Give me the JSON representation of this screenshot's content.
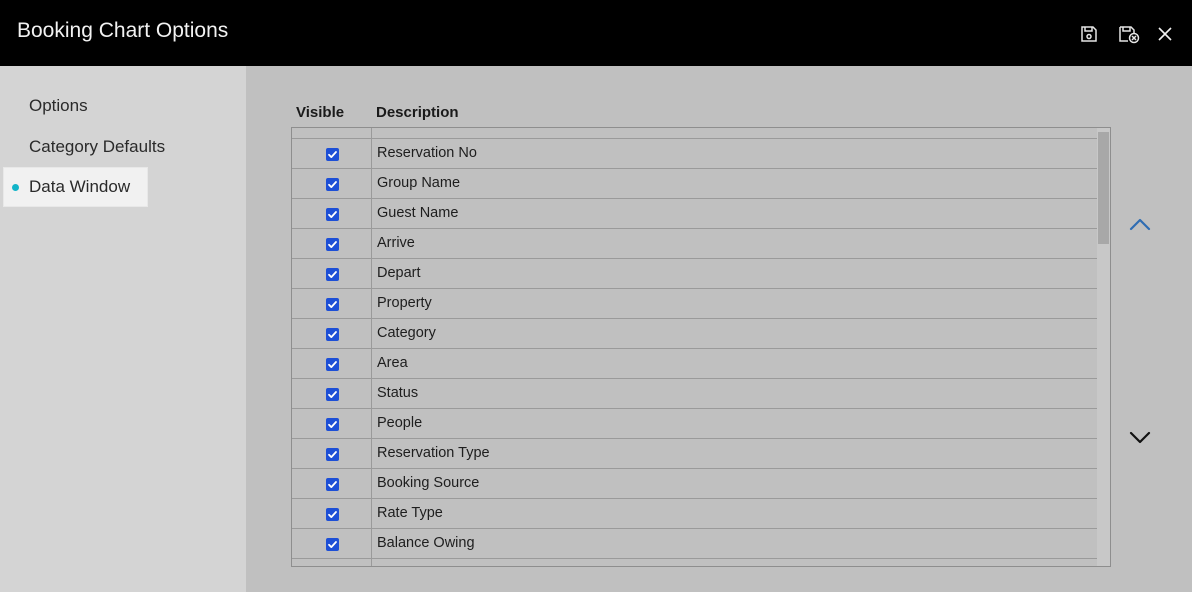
{
  "window": {
    "title": "Booking Chart Options",
    "buttons": [
      "save-icon",
      "save-close-icon",
      "close-icon"
    ]
  },
  "sidebar": {
    "items": [
      {
        "label": "Options",
        "active": false
      },
      {
        "label": "Category Defaults",
        "active": false
      },
      {
        "label": "Data Window",
        "active": true
      }
    ]
  },
  "table": {
    "headers": {
      "visible": "Visible",
      "description": "Description"
    },
    "rows": [
      {
        "visible": true,
        "description": "Reservation No"
      },
      {
        "visible": true,
        "description": "Group Name"
      },
      {
        "visible": true,
        "description": "Guest Name"
      },
      {
        "visible": true,
        "description": "Arrive"
      },
      {
        "visible": true,
        "description": "Depart"
      },
      {
        "visible": true,
        "description": "Property"
      },
      {
        "visible": true,
        "description": "Category"
      },
      {
        "visible": true,
        "description": "Area"
      },
      {
        "visible": true,
        "description": "Status"
      },
      {
        "visible": true,
        "description": "People"
      },
      {
        "visible": true,
        "description": "Reservation Type"
      },
      {
        "visible": true,
        "description": "Booking Source"
      },
      {
        "visible": true,
        "description": "Rate Type"
      },
      {
        "visible": true,
        "description": "Balance Owing"
      }
    ]
  },
  "controls": {
    "move_up_icon": "chevron-up-icon",
    "move_down_icon": "chevron-down-icon"
  },
  "colors": {
    "accent_dot": "#12b4c8",
    "checkbox": "#1d4fd6",
    "move_up_arrow": "#2f6db3"
  }
}
